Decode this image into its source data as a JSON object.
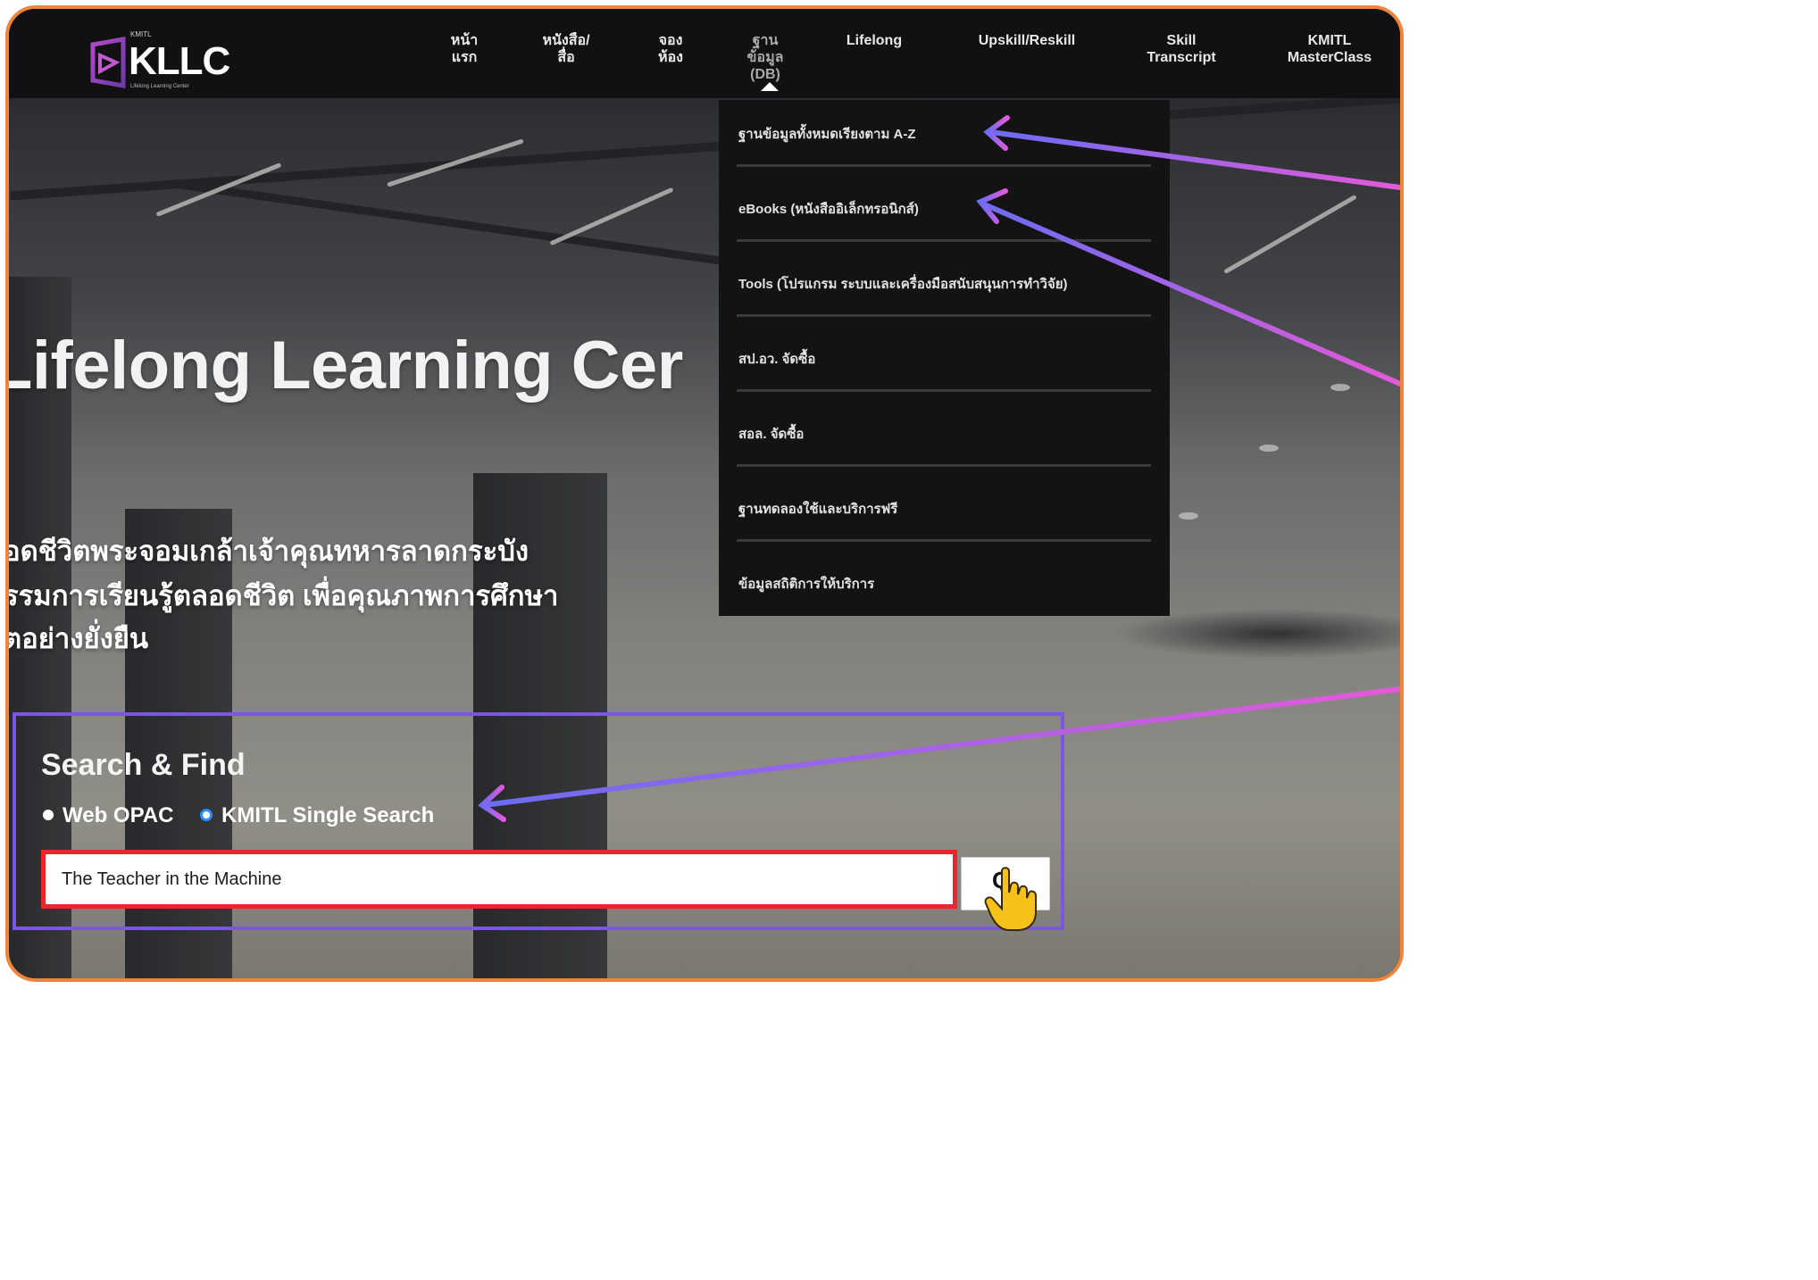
{
  "logo": {
    "brand": "KLLC",
    "org": "KMITL",
    "tagline": "Lifelong Learning Center"
  },
  "nav": {
    "items": [
      {
        "label": "หน้า\nแรก"
      },
      {
        "label": "หนังสือ/\nสื่อ"
      },
      {
        "label": "จอง\nห้อง"
      },
      {
        "label": "ฐาน\nข้อมูล\n(DB)"
      },
      {
        "label": "Lifelong"
      },
      {
        "label": "Upskill/Reskill"
      },
      {
        "label": "Skill\nTranscript"
      },
      {
        "label": "KMITL\nMasterClass"
      }
    ]
  },
  "dropdown": {
    "items": [
      {
        "label": "ฐานข้อมูลทั้งหมดเรียงตาม A-Z"
      },
      {
        "label": "eBooks (หนังสืออิเล็กทรอนิกส์)"
      },
      {
        "label": "Tools (โปรแกรม ระบบและเครื่องมือสนับสนุนการทำวิจัย)"
      },
      {
        "label": "สป.อว. จัดซื้อ"
      },
      {
        "label": "สอล. จัดซื้อ"
      },
      {
        "label": "ฐานทดลองใช้และบริการฟรี"
      },
      {
        "label": "ข้อมูลสถิติการให้บริการ"
      }
    ]
  },
  "hero": {
    "title": "Lifelong Learning Cer",
    "lines": [
      "อดชีวิตพระจอมเกล้าเจ้าคุณทหารลาดกระบัง",
      "รรมการเรียนรู้ตลอดชีวิต เพื่อคุณภาพการศึกษา",
      "ตอย่างยั่งยืน"
    ]
  },
  "search": {
    "title": "Search & Find",
    "options": [
      {
        "label": "Web OPAC",
        "selected": true
      },
      {
        "label": "KMITL Single Search",
        "selected": false
      }
    ],
    "query": "The Teacher in the Machine",
    "button_glyph": "Q"
  },
  "colors": {
    "frame_border": "#f0843a",
    "highlight_panel": "#7b55e6",
    "highlight_input": "#e8262e",
    "arrow_start": "#6b6cf2",
    "arrow_end": "#e45ad8",
    "radio_selected": "#ffffff",
    "radio_unselected_ring": "#2f8cff"
  },
  "icons": [
    "kllc-logo-icon",
    "caret-up-icon",
    "cursor-hand-icon",
    "search-icon"
  ]
}
